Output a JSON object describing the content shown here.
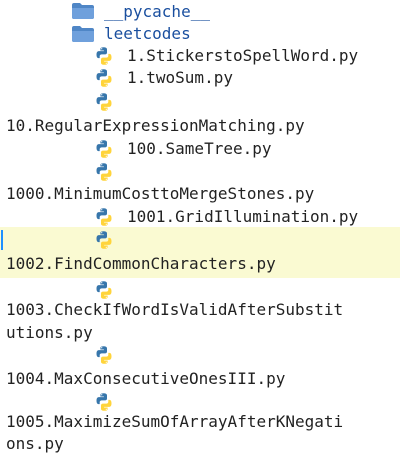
{
  "tree": {
    "folders": [
      {
        "name": "__pycache__",
        "icon": "folder-icon"
      },
      {
        "name": "leetcodes",
        "icon": "folder-icon"
      }
    ],
    "files": [
      {
        "name": "1.StickerstoSpellWord.py",
        "icon": "python-file-icon"
      },
      {
        "name": "1.twoSum.py",
        "icon": "python-file-icon"
      },
      {
        "name": "10.RegularExpressionMatching.py",
        "icon": "python-file-icon"
      },
      {
        "name": "100.SameTree.py",
        "icon": "python-file-icon"
      },
      {
        "name": "1000.MinimumCosttoMergeStones.py",
        "icon": "python-file-icon"
      },
      {
        "name": "1001.GridIllumination.py",
        "icon": "python-file-icon"
      },
      {
        "name": "1002.FindCommonCharacters.py",
        "icon": "python-file-icon",
        "selected": true
      },
      {
        "name_lines": [
          "1003.CheckIfWordIsValidAfterSubstit",
          "utions.py"
        ],
        "icon": "python-file-icon"
      },
      {
        "name": "1004.MaxConsecutiveOnesIII.py",
        "icon": "python-file-icon"
      },
      {
        "name_lines": [
          "1005.MaximizeSumOfArrayAfterKNegati",
          "ons.py"
        ],
        "icon": "python-file-icon"
      }
    ]
  },
  "colors": {
    "selected_bg": "#fafad2",
    "folder": "#4f86c6",
    "folder_text": "#1a4f9f",
    "python_blue": "#3776ab",
    "python_yellow": "#ffd43b",
    "selection_marker": "#1e90ff"
  }
}
